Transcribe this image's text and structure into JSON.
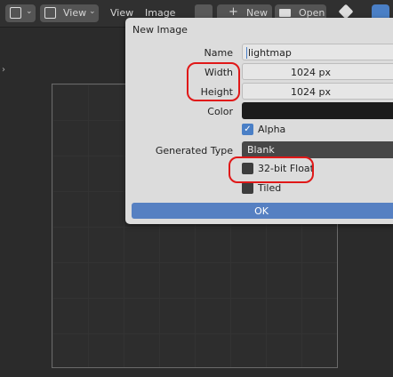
{
  "header": {
    "view_menu": "View",
    "menu_items": [
      "View",
      "Image"
    ],
    "new_button": "New",
    "open_button": "Open"
  },
  "dialog": {
    "title": "New Image",
    "name_label": "Name",
    "name_value": "lightmap",
    "width_label": "Width",
    "width_value": "1024 px",
    "height_label": "Height",
    "height_value": "1024 px",
    "color_label": "Color",
    "color_value": "#000000",
    "alpha_label": "Alpha",
    "alpha_checked": true,
    "generated_type_label": "Generated Type",
    "generated_type_value": "Blank",
    "float_label": "32-bit Float",
    "float_checked": false,
    "tiled_label": "Tiled",
    "tiled_checked": false,
    "ok_label": "OK"
  },
  "annotation_color": "#e01818"
}
